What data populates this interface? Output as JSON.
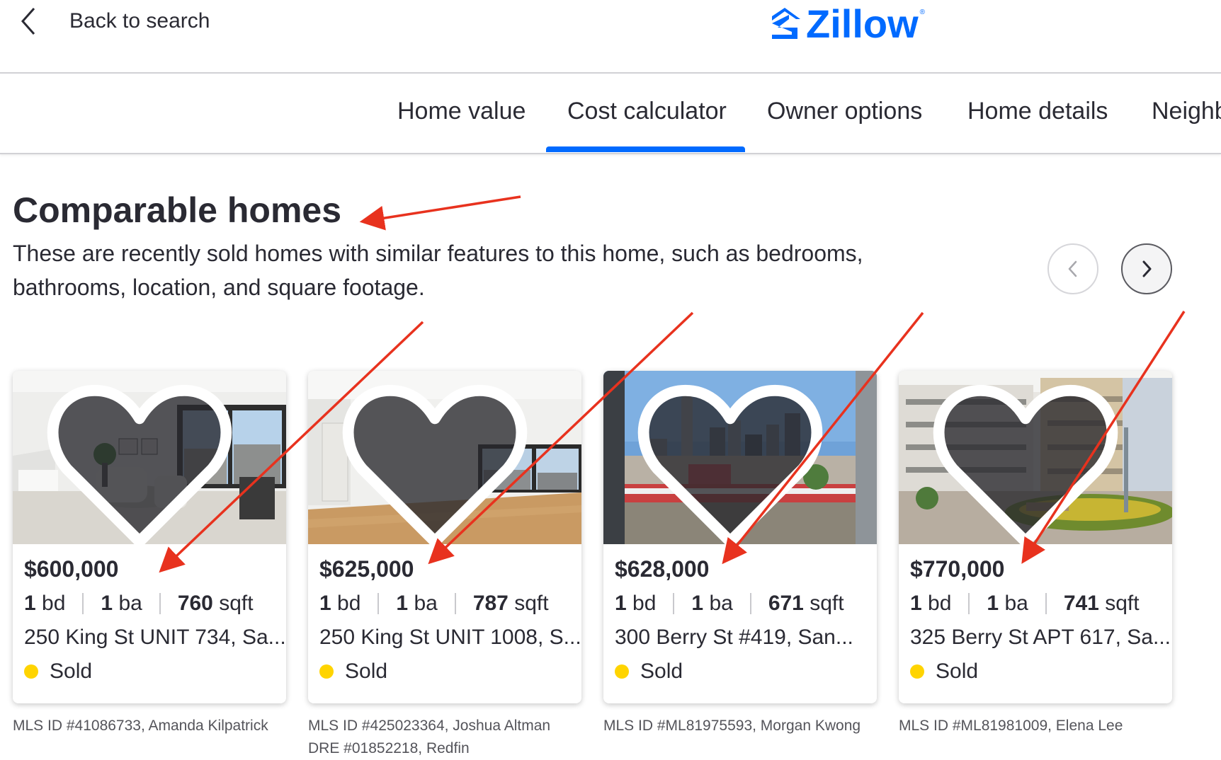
{
  "header": {
    "back_label": "Back to search",
    "logo_text": "Zillow",
    "logo_mark": "®",
    "brand_color": "#006aff"
  },
  "tabs": [
    {
      "label": "Home value"
    },
    {
      "label": "Cost calculator",
      "active": true
    },
    {
      "label": "Owner options"
    },
    {
      "label": "Home details"
    },
    {
      "label": "Neighb"
    }
  ],
  "section": {
    "title": "Comparable homes",
    "description": "These are recently sold homes with similar features to this home, such as bedrooms, bathrooms, location, and square footage."
  },
  "carousel": {
    "prev_icon": "chevron-left-icon",
    "next_icon": "chevron-right-icon"
  },
  "cards": [
    {
      "price": "$600,000",
      "beds": "1",
      "beds_unit": "bd",
      "baths": "1",
      "baths_unit": "ba",
      "sqft": "760",
      "sqft_unit": "sqft",
      "address": "250 King St UNIT 734, Sa...",
      "status": "Sold",
      "mls": "MLS ID #41086733, Amanda Kilpatrick"
    },
    {
      "price": "$625,000",
      "beds": "1",
      "beds_unit": "bd",
      "baths": "1",
      "baths_unit": "ba",
      "sqft": "787",
      "sqft_unit": "sqft",
      "address": "250 King St UNIT 1008, S...",
      "status": "Sold",
      "mls": "MLS ID #425023364, Joshua Altman DRE #01852218, Redfin"
    },
    {
      "price": "$628,000",
      "beds": "1",
      "beds_unit": "bd",
      "baths": "1",
      "baths_unit": "ba",
      "sqft": "671",
      "sqft_unit": "sqft",
      "address": "300 Berry St #419, San...",
      "status": "Sold",
      "mls": "MLS ID #ML81975593, Morgan Kwong"
    },
    {
      "price": "$770,000",
      "beds": "1",
      "beds_unit": "bd",
      "baths": "1",
      "baths_unit": "ba",
      "sqft": "741",
      "sqft_unit": "sqft",
      "address": "325 Berry St APT 617, Sa...",
      "status": "Sold",
      "mls": "MLS ID #ML81981009, Elena Lee"
    }
  ],
  "colors": {
    "sold_dot": "#ffd400",
    "annotation": "#e8321e",
    "text": "#2a2a33"
  }
}
